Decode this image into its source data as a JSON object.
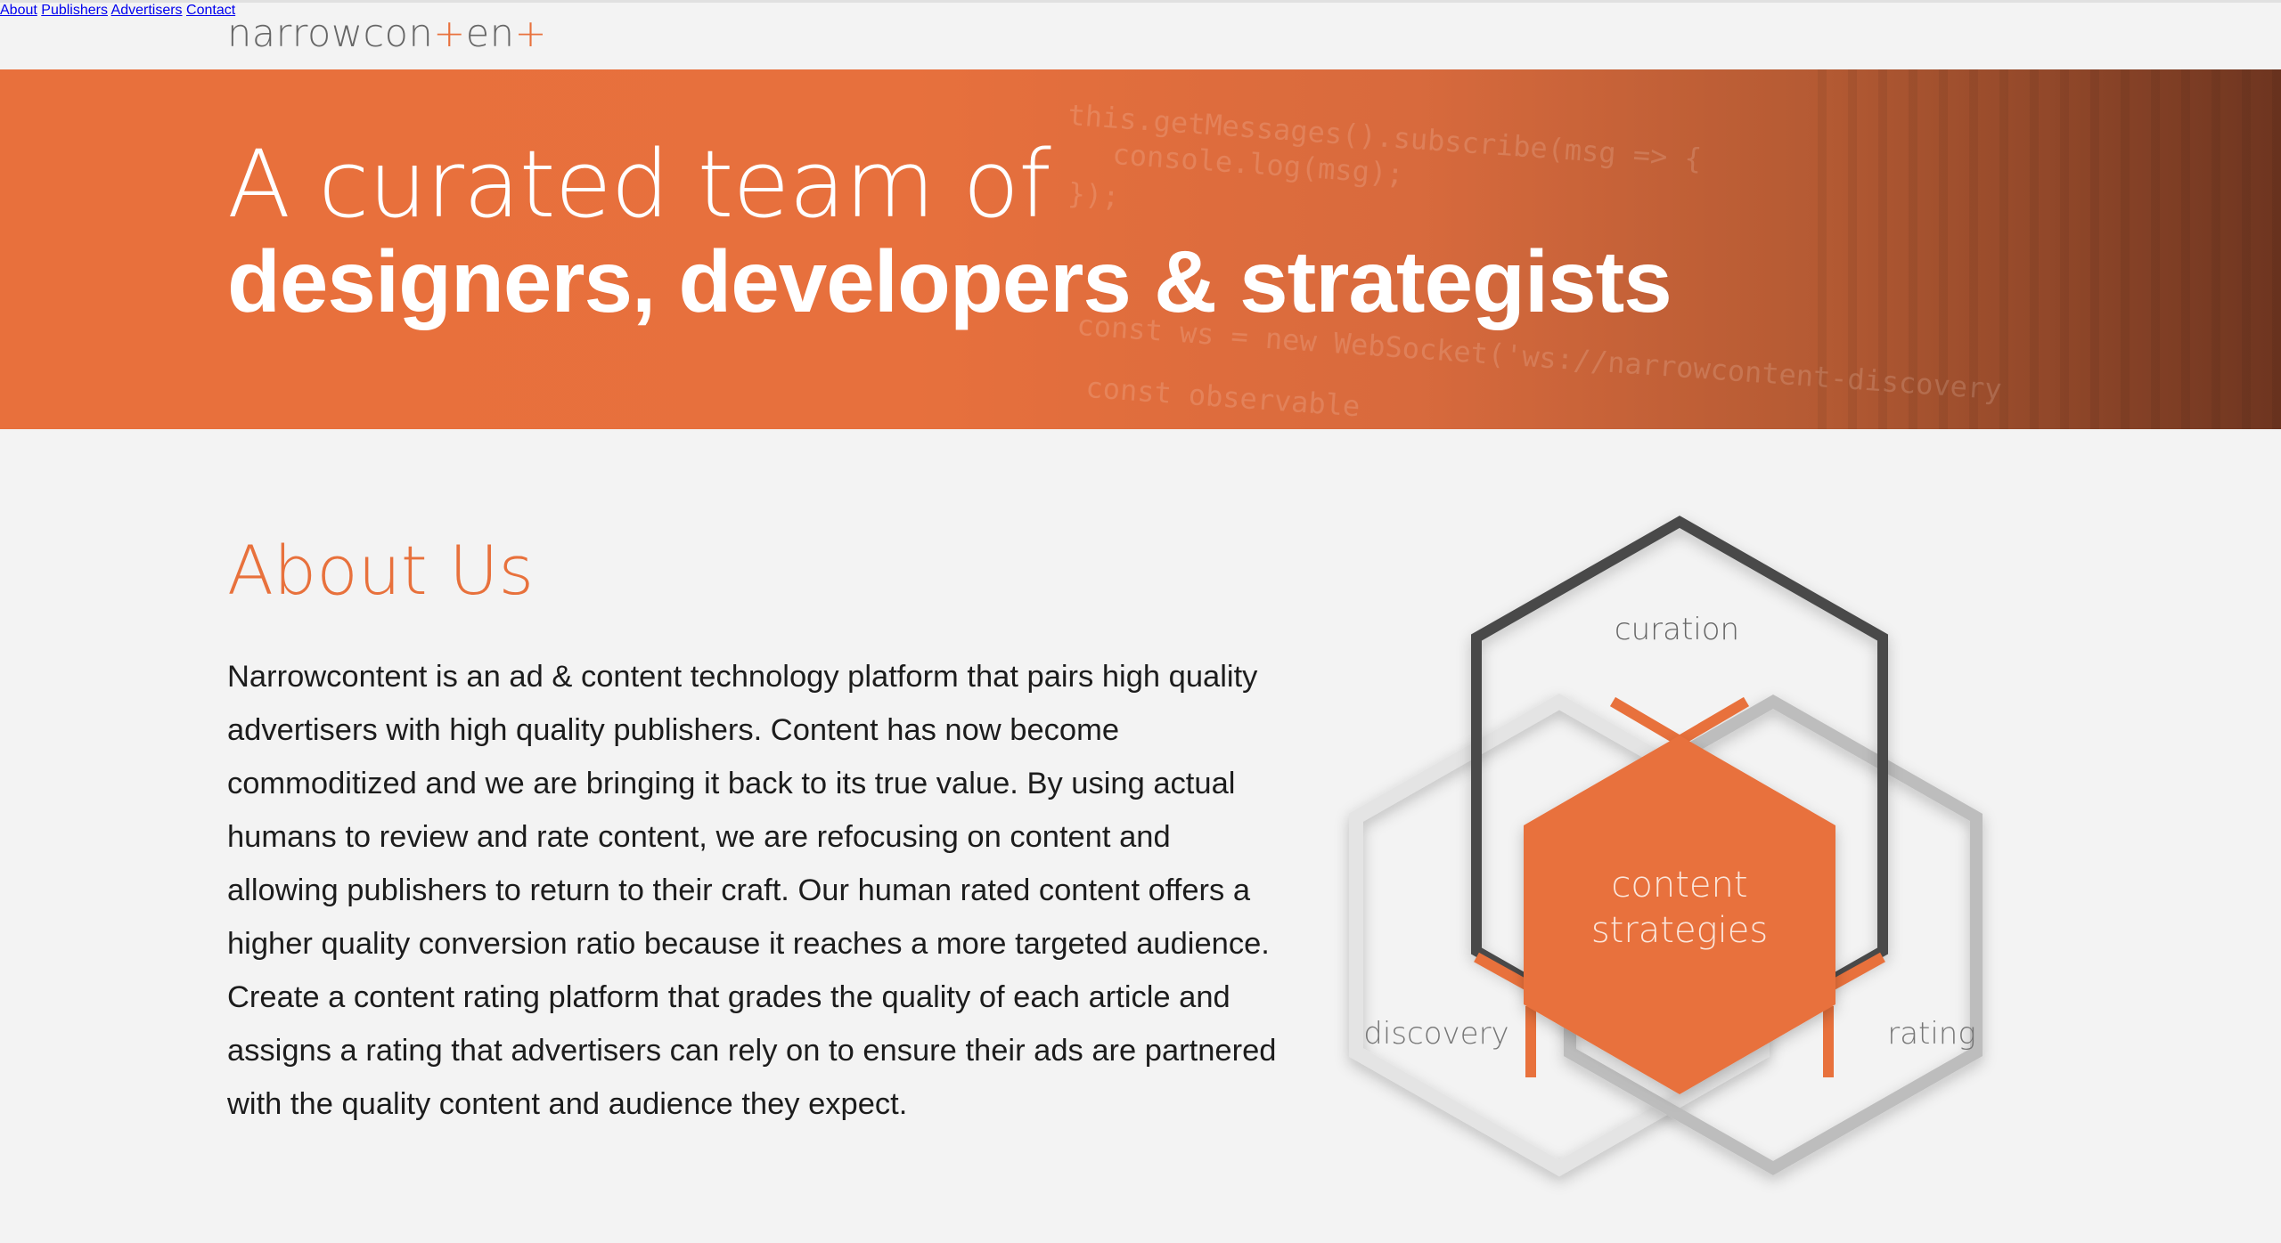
{
  "logo": {
    "part1": "narrowcon",
    "plus1": "+",
    "part2": "en",
    "plus2": "+"
  },
  "nav": {
    "items": [
      {
        "label": "About"
      },
      {
        "label": "Publishers"
      },
      {
        "label": "Advertisers"
      },
      {
        "label": "Contact"
      }
    ]
  },
  "hero": {
    "line1": "A curated team of",
    "line2": "designers, developers & strategists",
    "code_lines": [
      "this.getMessages().subscribe(msg => {",
      "console.log(msg);",
      "});",
      "const ws = new WebSocket('ws://narrowcontent-discovery",
      "const observable"
    ]
  },
  "about": {
    "title": "About Us",
    "body": "Narrowcontent is an ad & content technology platform that pairs high quality advertisers with high quality publishers. Content has now become commoditized and we are bringing it back to its true value. By using actual humans to review and rate content, we are refocusing on content and allowing publishers to return to their craft. Our human rated content offers a higher quality conversion ratio because it reaches a more targeted audience. Create a content rating platform that grades the quality of each article and assigns a rating that advertisers can rely on to ensure their ads are partnered with the quality content and audience they expect."
  },
  "diagram": {
    "top_label": "curation",
    "left_label": "discovery",
    "right_label": "rating",
    "center_line1": "content",
    "center_line2": "strategies"
  },
  "colors": {
    "accent": "#e8713c",
    "dark_hex": "#4a4a4a",
    "light_hex": "#bdbdbd"
  }
}
